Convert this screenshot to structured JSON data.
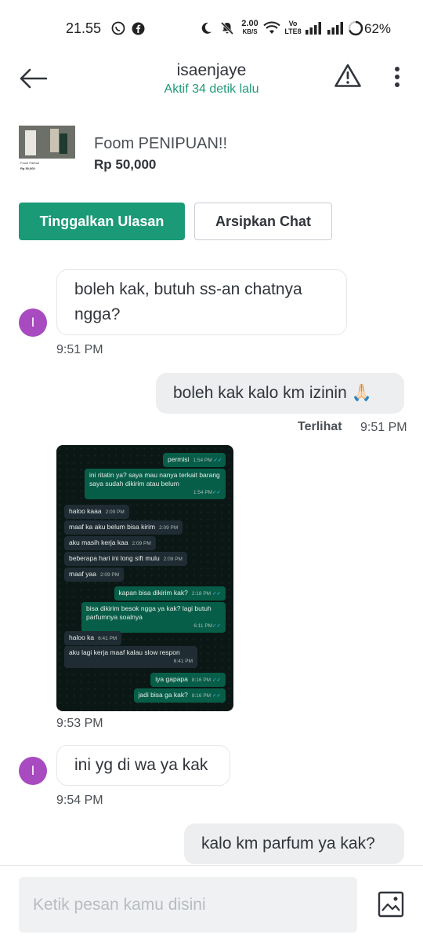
{
  "status_bar": {
    "time": "21.55",
    "net_speed_value": "2.00",
    "net_speed_unit": "KB/S",
    "volte_top": "Vo",
    "volte_bottom": "LTE8",
    "battery": "62%"
  },
  "header": {
    "title": "isaenjaye",
    "subtitle": "Aktif 34 detik lalu"
  },
  "product": {
    "name": "Foom PENIPUAN!!",
    "price": "Rp 50,000",
    "thumb_name": "Foom Parfum",
    "thumb_price": "Rp 50,000"
  },
  "actions": {
    "review_label": "Tinggalkan Ulasan",
    "archive_label": "Arsipkan Chat"
  },
  "avatar_initial": "I",
  "messages": [
    {
      "text": "boleh kak, butuh ss-an chatnya ngga?",
      "time": "9:51 PM"
    },
    {
      "text": "boleh kak kalo km izinin 🙏🏻",
      "seen": "Terlihat",
      "time": "9:51 PM"
    },
    {
      "time": "9:53 PM"
    },
    {
      "text": "ini yg di wa ya kak",
      "time": "9:54 PM"
    },
    {
      "text": "kalo km parfum ya kak?"
    }
  ],
  "wa_chat": [
    {
      "text": "permisi",
      "time": "1:54 PM"
    },
    {
      "text": "ini ritatin ya? saya mau nanya terkait barang saya sudah dikirim atau belum",
      "time": "1:54 PM"
    },
    {
      "text": "haloo kaaa",
      "time": "2:09 PM"
    },
    {
      "text": "maaf ka aku belum bisa kirim",
      "time": "2:09 PM"
    },
    {
      "text": "aku masih kerja kaa",
      "time": "2:09 PM"
    },
    {
      "text": "beberapa hari ini long sift mulu",
      "time": "2:09 PM"
    },
    {
      "text": "maaf yaa",
      "time": "2:09 PM"
    },
    {
      "text": "kapan bisa dikirim kak?",
      "time": "2:18 PM"
    },
    {
      "text": "bisa dikirim besok ngga ya kak? lagi butuh parfumnya soalnya",
      "time": "6:11 PM"
    },
    {
      "text": "haloo ka",
      "time": "6:41 PM"
    },
    {
      "text": "aku lagi kerja maaf kalau slow respon",
      "time": "6:41 PM"
    },
    {
      "text": "iya gapapa",
      "time": "8:16 PM"
    },
    {
      "text": "jadi bisa ga kak?",
      "time": "8:16 PM"
    }
  ],
  "composer": {
    "placeholder": "Ketik pesan kamu disini"
  },
  "colors": {
    "accent": "#1b9a77",
    "online": "#1f9a78",
    "avatar": "#a84ac0",
    "bubble_out": "#edeef0"
  }
}
